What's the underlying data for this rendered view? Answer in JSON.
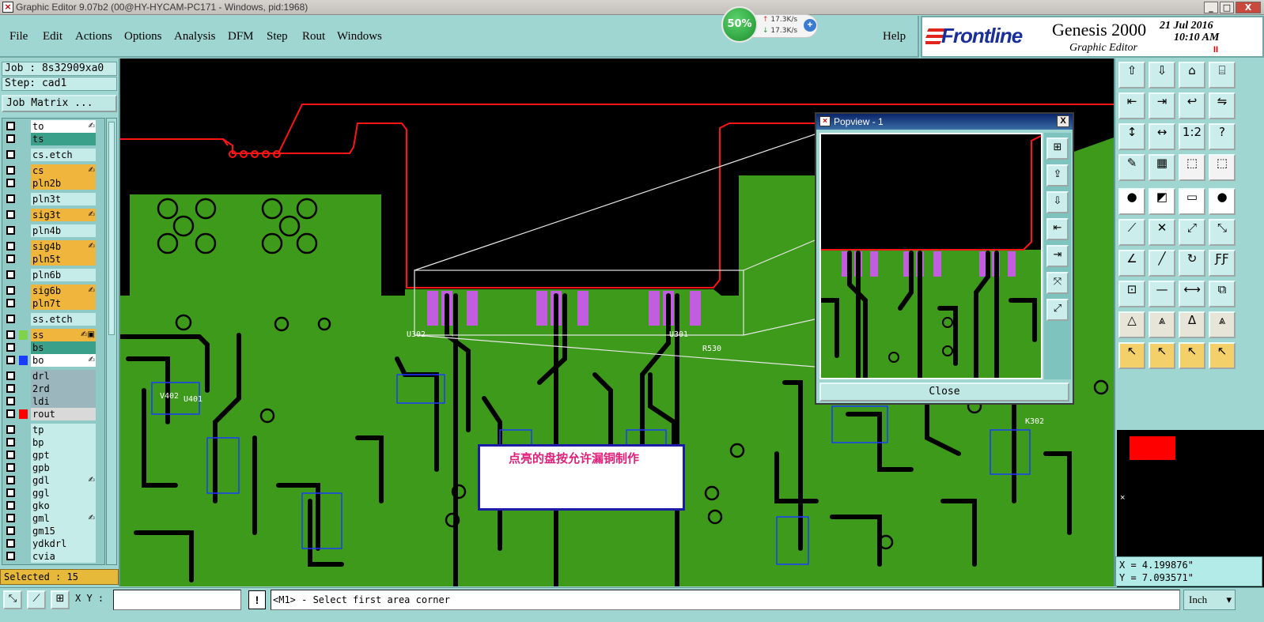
{
  "window": {
    "title": "Graphic Editor 9.07b2 (00@HY-HYCAM-PC171 - Windows, pid:1968)",
    "controls": [
      "_",
      "□",
      "X"
    ]
  },
  "menubar": {
    "items": [
      "File",
      "Edit",
      "Actions",
      "Options",
      "Analysis",
      "DFM",
      "Step",
      "Rout",
      "Windows"
    ],
    "help": "Help"
  },
  "network_widget": {
    "percent": "50%",
    "upload": "17.3K/s",
    "download": "17.3K/s"
  },
  "brand": {
    "logo": "Frontline",
    "product": "Genesis 2000",
    "subtitle": "Graphic Editor",
    "date": "21 Jul 2016",
    "time": "10:10 AM",
    "indicator": "II"
  },
  "job": {
    "job_label": "Job : 8s32909xa0",
    "step_label": "Step: cad1",
    "job_matrix": "Job Matrix ..."
  },
  "layers": [
    {
      "name": "to",
      "bg": "#ffffff",
      "swatch": "",
      "edit": "✍"
    },
    {
      "name": "ts",
      "bg": "#3aa08a",
      "swatch": "",
      "edit": ""
    },
    {
      "name": "cs.etch",
      "bg": "#c6ecea",
      "swatch": "",
      "edit": ""
    },
    {
      "name": "cs",
      "bg": "#f0b53c",
      "swatch": "",
      "edit": "✍"
    },
    {
      "name": "pln2b",
      "bg": "#f0b53c",
      "swatch": "",
      "edit": ""
    },
    {
      "name": "pln3t",
      "bg": "#c6ecea",
      "swatch": "",
      "edit": ""
    },
    {
      "name": "sig3t",
      "bg": "#f0b53c",
      "swatch": "",
      "edit": "✍"
    },
    {
      "name": "pln4b",
      "bg": "#c6ecea",
      "swatch": "",
      "edit": ""
    },
    {
      "name": "sig4b",
      "bg": "#f0b53c",
      "swatch": "",
      "edit": "✍"
    },
    {
      "name": "pln5t",
      "bg": "#f0b53c",
      "swatch": "",
      "edit": ""
    },
    {
      "name": "pln6b",
      "bg": "#c6ecea",
      "swatch": "",
      "edit": ""
    },
    {
      "name": "sig6b",
      "bg": "#f0b53c",
      "swatch": "",
      "edit": "✍"
    },
    {
      "name": "pln7t",
      "bg": "#f0b53c",
      "swatch": "",
      "edit": ""
    },
    {
      "name": "ss.etch",
      "bg": "#c6ecea",
      "swatch": "",
      "edit": ""
    },
    {
      "name": "ss",
      "bg": "#f0b53c",
      "swatch": "#7fd24a",
      "edit": "✍▣"
    },
    {
      "name": "bs",
      "bg": "#3aa08a",
      "swatch": "",
      "edit": ""
    },
    {
      "name": "bo",
      "bg": "#ffffff",
      "swatch": "#1a3cff",
      "edit": "✍"
    },
    {
      "name": "drl",
      "bg": "#9cb6bd",
      "swatch": "",
      "edit": ""
    },
    {
      "name": "2rd",
      "bg": "#9cb6bd",
      "swatch": "",
      "edit": ""
    },
    {
      "name": "ldi",
      "bg": "#9cb6bd",
      "swatch": "",
      "edit": ""
    },
    {
      "name": "rout",
      "bg": "#d9d9d9",
      "swatch": "#ff0000",
      "edit": ""
    },
    {
      "name": "tp",
      "bg": "#c6ecea",
      "swatch": "",
      "edit": ""
    },
    {
      "name": "bp",
      "bg": "#c6ecea",
      "swatch": "",
      "edit": ""
    },
    {
      "name": "gpt",
      "bg": "#c6ecea",
      "swatch": "",
      "edit": ""
    },
    {
      "name": "gpb",
      "bg": "#c6ecea",
      "swatch": "",
      "edit": ""
    },
    {
      "name": "gdl",
      "bg": "#c6ecea",
      "swatch": "",
      "edit": "✍"
    },
    {
      "name": "ggl",
      "bg": "#c6ecea",
      "swatch": "",
      "edit": ""
    },
    {
      "name": "gko",
      "bg": "#c6ecea",
      "swatch": "",
      "edit": ""
    },
    {
      "name": "gml",
      "bg": "#c6ecea",
      "swatch": "",
      "edit": "✍"
    },
    {
      "name": "gm15",
      "bg": "#c6ecea",
      "swatch": "",
      "edit": ""
    },
    {
      "name": "ydkdrl",
      "bg": "#c6ecea",
      "swatch": "",
      "edit": ""
    },
    {
      "name": "cvia",
      "bg": "#c6ecea",
      "swatch": "",
      "edit": ""
    }
  ],
  "selected": "Selected : 15",
  "note": "点亮的盘按允许漏铜制作",
  "popview": {
    "title": "Popview - 1",
    "close_x": "X",
    "close": "Close",
    "buttons": [
      "⊞",
      "⇪",
      "⇩",
      "⇤",
      "⇥",
      "⤧",
      "⤢"
    ]
  },
  "tools": [
    [
      "⇧",
      "⇩",
      "⌂",
      "⌸"
    ],
    [
      "⇤",
      "⇥",
      "↩",
      "⇋"
    ],
    [
      "↕",
      "↔",
      "1:2",
      "?"
    ],
    [
      "✎",
      "▦",
      "⬚",
      "⬚"
    ],
    [
      "●",
      "◩",
      "▭",
      "●"
    ],
    [
      "⟋",
      "✕",
      "⤢",
      "⤡"
    ],
    [
      "∠",
      "╱",
      "↻",
      "ƑƑ"
    ],
    [
      "⊡",
      "—",
      "⟷",
      "⧉"
    ],
    [
      "△",
      "⩓",
      "Δ",
      "⩓"
    ],
    [
      "↖",
      "↖",
      "↖",
      "↖"
    ]
  ],
  "coords": {
    "x": "X = 4.199876\"",
    "y": "Y = 7.093571\""
  },
  "status": {
    "xy_label": "X Y :",
    "xy_value": "",
    "warn": "!",
    "prompt": "<M1> - Select first area corner",
    "units": "Inch",
    "buttons": [
      "⤡",
      "⟋",
      "⊞"
    ]
  },
  "canvas_labels": {
    "comp1": "U302",
    "comp2": "U301",
    "comp3": "R530",
    "comp4": "U401",
    "comp5": "V402",
    "comp6": "K302"
  }
}
